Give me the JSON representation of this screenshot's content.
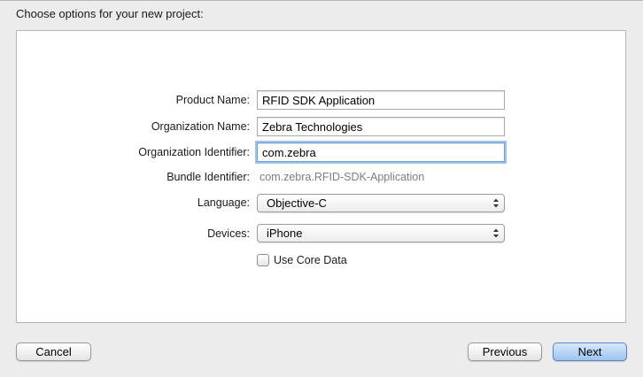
{
  "header": {
    "title": "Choose options for your new project:"
  },
  "form": {
    "product_name": {
      "label": "Product Name:",
      "value": "RFID SDK Application"
    },
    "organization_name": {
      "label": "Organization Name:",
      "value": "Zebra Technologies"
    },
    "organization_identifier": {
      "label": "Organization Identifier:",
      "value": "com.zebra"
    },
    "bundle_identifier": {
      "label": "Bundle Identifier:",
      "value": "com.zebra.RFID-SDK-Application"
    },
    "language": {
      "label": "Language:",
      "value": "Objective-C"
    },
    "devices": {
      "label": "Devices:",
      "value": "iPhone"
    },
    "use_core_data": {
      "label": "Use Core Data",
      "checked": false
    }
  },
  "footer": {
    "cancel_label": "Cancel",
    "previous_label": "Previous",
    "next_label": "Next"
  }
}
